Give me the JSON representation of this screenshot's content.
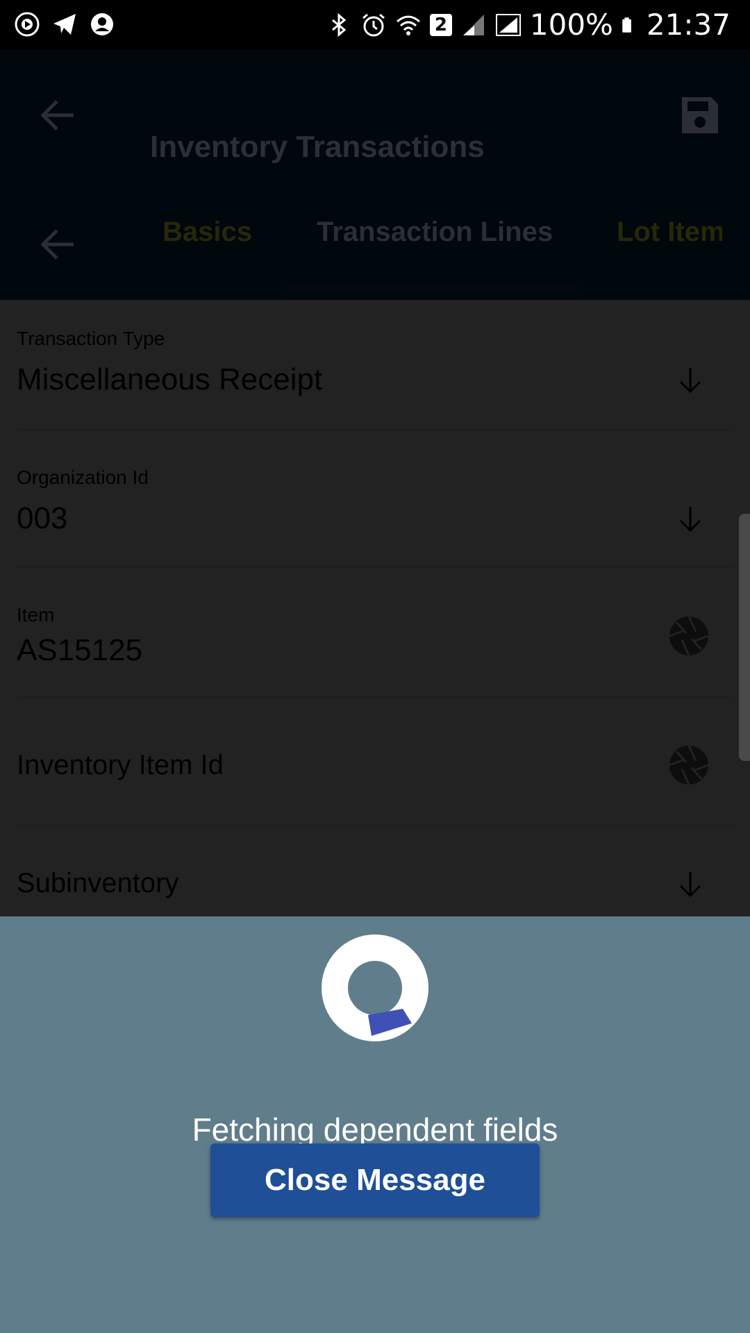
{
  "status_bar": {
    "left_icons": [
      "play-circle-icon",
      "telegram-icon",
      "account-circle-icon"
    ],
    "right_icons": [
      "bluetooth-icon",
      "alarm-icon",
      "wifi-icon",
      "signal-icon"
    ],
    "sim_badge": "2",
    "battery": "100%",
    "time": "21:37"
  },
  "app_bar": {
    "title": "Inventory Transactions",
    "back_icon": "arrow-left-icon",
    "save_icon": "save-icon"
  },
  "tabs": {
    "items": [
      "Basics",
      "Transaction Lines",
      "Lot Item"
    ]
  },
  "form": {
    "transaction_type": {
      "label": "Transaction Type",
      "value": "Miscellaneous Receipt"
    },
    "organization_id": {
      "label": "Organization Id",
      "value": "003"
    },
    "item": {
      "label": "Item",
      "value": "AS15125"
    },
    "inventory_item_id": {
      "label": "Inventory Item Id"
    },
    "subinventory": {
      "label": "Subinventory"
    }
  },
  "overlay": {
    "message": "Fetching dependent fields",
    "close_label": "Close Message",
    "colors": {
      "sheet": "#607d8b",
      "button": "#1e4f97",
      "spinner_accent": "#3f51b5"
    }
  }
}
